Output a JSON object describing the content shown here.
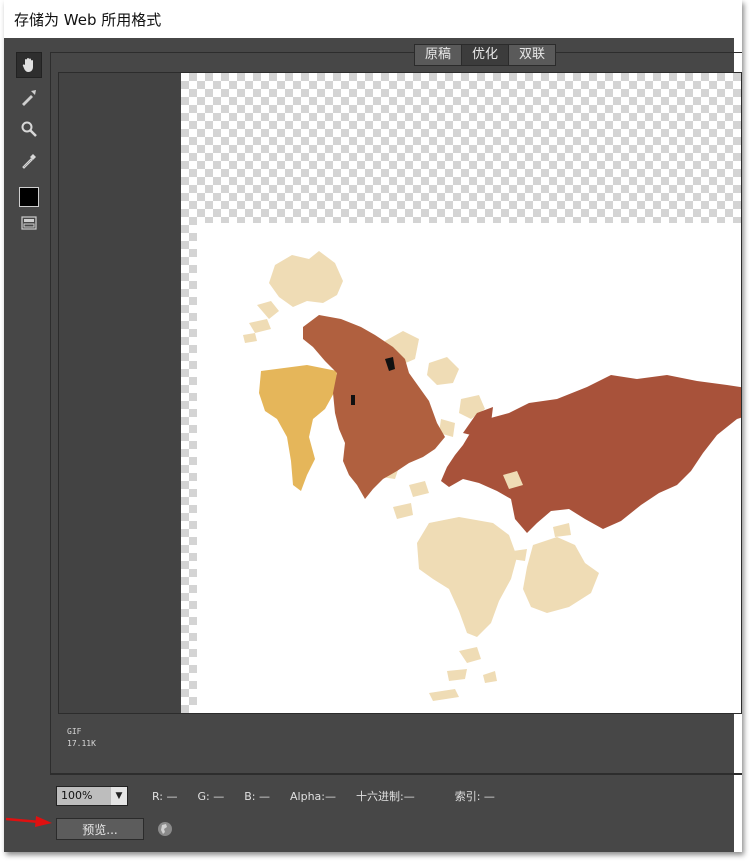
{
  "window": {
    "title": "存储为 Web 所用格式"
  },
  "tools": [
    {
      "name": "hand-icon"
    },
    {
      "name": "slice-select-icon"
    },
    {
      "name": "zoom-icon"
    },
    {
      "name": "eyedropper-icon"
    },
    {
      "name": "color-swatch",
      "color": "#000000"
    },
    {
      "name": "toggle-slices-icon"
    }
  ],
  "tabs": [
    {
      "label": "原稿",
      "active": false
    },
    {
      "label": "优化",
      "active": true
    },
    {
      "label": "双联",
      "active": false
    }
  ],
  "image_info": {
    "format": "GIF",
    "size": "17.11K"
  },
  "status": {
    "zoom": "100%",
    "r": "R: —",
    "g": "G: —",
    "b": "B: —",
    "alpha": "Alpha:—",
    "hex": "十六进制:—",
    "index": "索引: —"
  },
  "preview_button": {
    "label": "预览..."
  },
  "map_colors": {
    "asia_europe": "#a8523a",
    "north_america": "#b0603f",
    "south_america": "#e5b65a",
    "light": "#efdcb5"
  }
}
